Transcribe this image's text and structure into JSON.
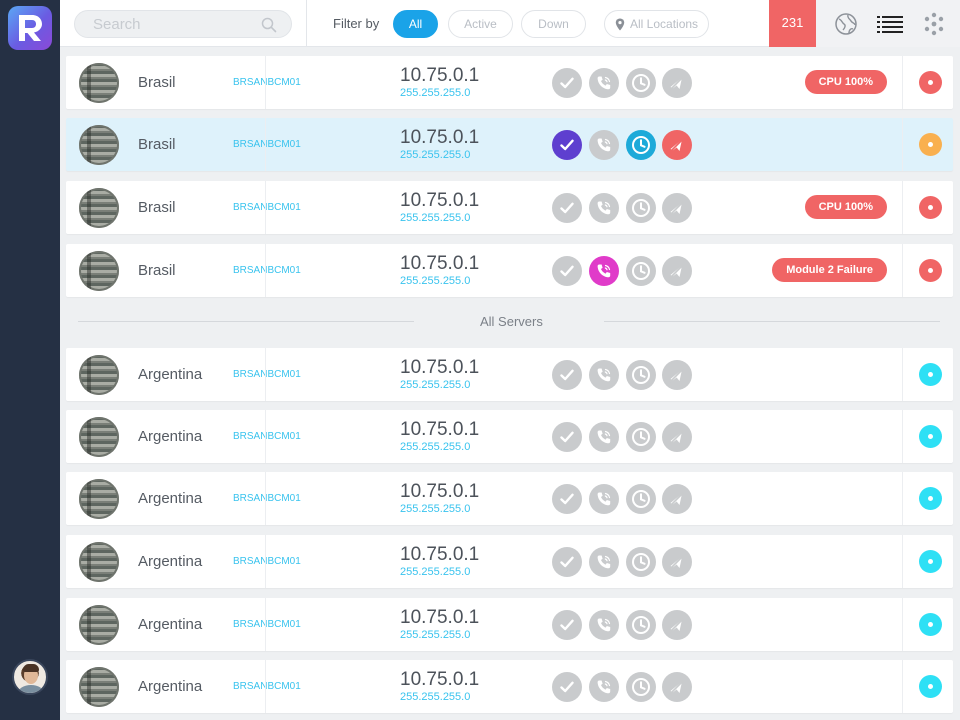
{
  "app": {
    "logo_letter": "R"
  },
  "search": {
    "placeholder": "Search"
  },
  "filter": {
    "label": "Filter by",
    "options": [
      {
        "label": "All",
        "active": true
      },
      {
        "label": "Active",
        "active": false
      },
      {
        "label": "Down",
        "active": false
      }
    ],
    "location": "All Locations"
  },
  "header": {
    "alert_count": "231",
    "icons": [
      "globe-icon",
      "list-icon",
      "grid-dots-icon"
    ]
  },
  "section": {
    "all_servers_label": "All Servers"
  },
  "colors": {
    "accent": "#1aa3e8",
    "alert": "#f06565",
    "status_red": "#f06565",
    "status_orange": "#f9b04f",
    "status_cyan": "#2ee0f5",
    "check_purple": "#5e3fcf",
    "phone_magenta": "#e03bc9",
    "clock_blue": "#1daad9",
    "mute_red": "#f06565"
  },
  "pinned_rows": [
    {
      "country": "Brasil",
      "host": "BRSANBCM01",
      "ip": "10.75.0.1",
      "mask": "255.255.255.0",
      "alert": "CPU 100%",
      "status": "red"
    },
    {
      "country": "Brasil",
      "host": "BRSANBCM01",
      "ip": "10.75.0.1",
      "mask": "255.255.255.0",
      "alert": "",
      "status": "orange",
      "selected": true
    },
    {
      "country": "Brasil",
      "host": "BRSANBCM01",
      "ip": "10.75.0.1",
      "mask": "255.255.255.0",
      "alert": "CPU 100%",
      "status": "red"
    },
    {
      "country": "Brasil",
      "host": "BRSANBCM01",
      "ip": "10.75.0.1",
      "mask": "255.255.255.0",
      "alert": "Module 2 Failure",
      "status": "red",
      "phone_active": true
    }
  ],
  "server_rows": [
    {
      "country": "Argentina",
      "host": "BRSANBCM01",
      "ip": "10.75.0.1",
      "mask": "255.255.255.0",
      "status": "cyan"
    },
    {
      "country": "Argentina",
      "host": "BRSANBCM01",
      "ip": "10.75.0.1",
      "mask": "255.255.255.0",
      "status": "cyan"
    },
    {
      "country": "Argentina",
      "host": "BRSANBCM01",
      "ip": "10.75.0.1",
      "mask": "255.255.255.0",
      "status": "cyan"
    },
    {
      "country": "Argentina",
      "host": "BRSANBCM01",
      "ip": "10.75.0.1",
      "mask": "255.255.255.0",
      "status": "cyan"
    },
    {
      "country": "Argentina",
      "host": "BRSANBCM01",
      "ip": "10.75.0.1",
      "mask": "255.255.255.0",
      "status": "cyan"
    },
    {
      "country": "Argentina",
      "host": "BRSANBCM01",
      "ip": "10.75.0.1",
      "mask": "255.255.255.0",
      "status": "cyan"
    }
  ]
}
